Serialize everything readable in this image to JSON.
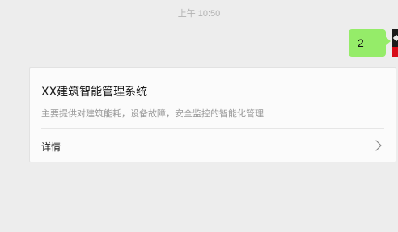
{
  "chat": {
    "timestamp": "上午 10:50",
    "message": {
      "text": "2",
      "bubble_color": "#95ec69"
    },
    "avatar": {
      "colors": [
        "#1a1a1a",
        "#d80c18"
      ]
    }
  },
  "card": {
    "title": "XX建筑智能管理系统",
    "description": "主要提供对建筑能耗，设备故障，安全监控的智能化管理",
    "detail_label": "详情",
    "detail_icon": "chevron-right-icon"
  }
}
